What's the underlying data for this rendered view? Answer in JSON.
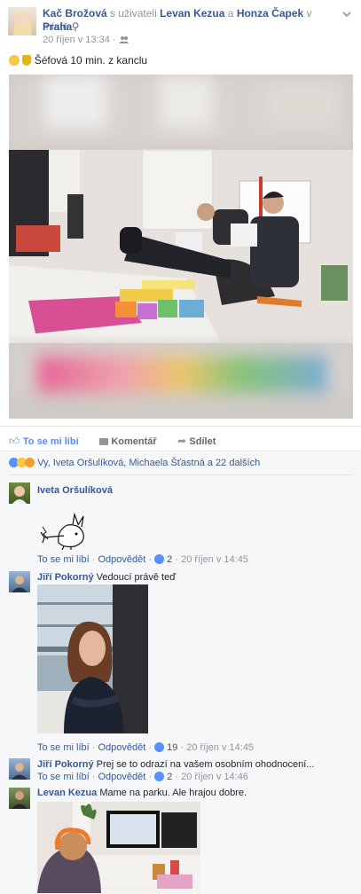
{
  "post": {
    "author": "Kač Brožová",
    "with_text": "s uživateli",
    "tagged1": "Levan Kezua",
    "and_text": "a",
    "tagged2": "Honza Čapek",
    "in_place_text": "v místě",
    "place": "Praha",
    "place_suffix": ".",
    "timestamp": "20 říjen v 13:34",
    "audience_separator": "·",
    "status_text": "Šéfová 10 min. z kanclu"
  },
  "actions": {
    "like": "To se mi líbí",
    "comment": "Komentář",
    "share": "Sdílet"
  },
  "reactions": {
    "summary": "Vy, Iveta Oršulíková, Michaela Šťastná a 22 dalších"
  },
  "comments": [
    {
      "author": "Iveta Oršulíková",
      "text": "",
      "like": "To se mi líbí",
      "sep": "·",
      "reply": "Odpovědět",
      "count": "2",
      "time": "20 říjen v 14:45"
    },
    {
      "author": "Jiří Pokorný",
      "text": "Vedoucí právě teď",
      "like": "To se mi líbí",
      "sep": "·",
      "reply": "Odpovědět",
      "count": "19",
      "time": "20 říjen v 14:45"
    },
    {
      "author": "Jiří Pokorný",
      "text": "Prej se to odrazí na vašem osobním ohodnocení...",
      "like": "To se mi líbí",
      "sep": "·",
      "reply": "Odpovědět",
      "count": "2",
      "time": "20 říjen v 14:46"
    },
    {
      "author": "Levan Kezua",
      "text": "Mame na parku. Ale hrajou dobre."
    }
  ],
  "icons": {
    "menu": "chevron-down-icon",
    "place": "map-pin-icon",
    "audience": "friends-icon",
    "like": "thumbs-up-icon",
    "comment": "speech-bubble-icon",
    "share": "share-arrow-icon"
  },
  "colors": {
    "link": "#365899",
    "muted": "#90949c",
    "like_blue": "#598dfb",
    "background": "#e9ebee"
  }
}
